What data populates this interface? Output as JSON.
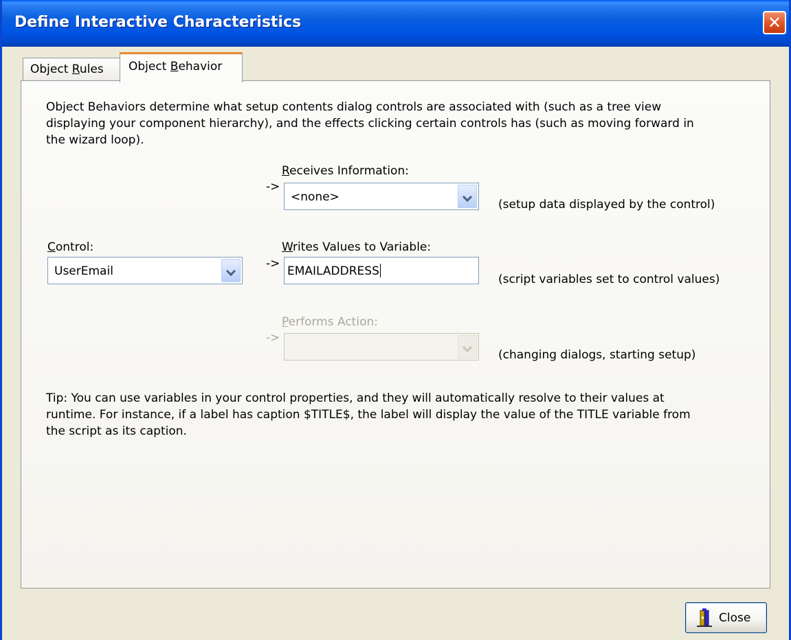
{
  "window": {
    "title": "Define Interactive Characteristics"
  },
  "tabs": [
    {
      "label_pre": "Object ",
      "label_accel": "R",
      "label_post": "ules"
    },
    {
      "label_pre": "Object ",
      "label_accel": "B",
      "label_post": "ehavior"
    }
  ],
  "panel": {
    "intro_lines": [
      "Object Behaviors determine what setup contents dialog controls are associated with (such as a tree view",
      "displaying your component hierarchy), and the effects clicking certain controls has (such as moving forward in",
      "the wizard loop)."
    ],
    "receives": {
      "label_accel": "R",
      "label_rest": "eceives Information:",
      "arrow": "->",
      "value": "<none>",
      "hint": "(setup data displayed by the control)"
    },
    "control": {
      "label_accel": "C",
      "label_rest": "ontrol:",
      "value": "UserEmail"
    },
    "writes": {
      "label_accel": "W",
      "label_rest": "rites Values to Variable:",
      "arrow": "->",
      "value": "EMAILADDRESS",
      "hint": "(script variables set to control values)"
    },
    "performs": {
      "label_accel": "P",
      "label_rest": "erforms Action:",
      "arrow": "->",
      "value": "",
      "hint": "(changing dialogs, starting setup)"
    },
    "tip_lines": [
      "Tip: You can use variables in your control properties, and they will automatically resolve to their values at",
      "runtime. For instance, if a label has caption $TITLE$, the label will display the value of the TITLE variable from",
      "the script as its caption."
    ]
  },
  "buttons": {
    "close_label": "Close"
  },
  "icons": {
    "close_window": "close-x-icon",
    "close_button": "exit-door-icon",
    "dropdown": "chevron-down-icon"
  },
  "colors": {
    "titlebar": "#0054e3",
    "close_button_red": "#e0582c",
    "active_tab_accent": "#e68b2c",
    "disabled_text": "#aca899"
  }
}
